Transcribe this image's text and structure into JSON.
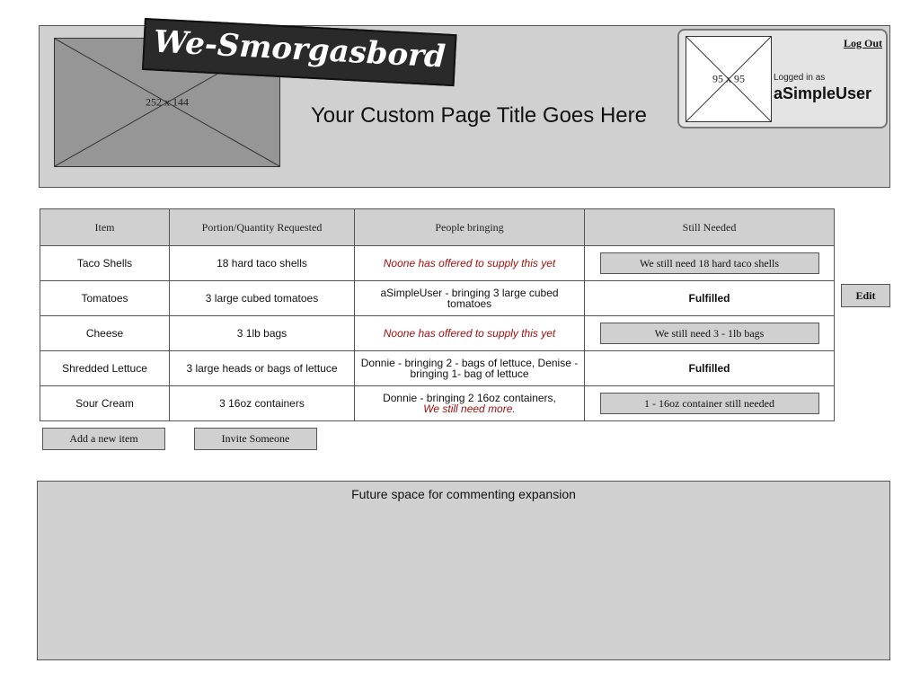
{
  "header": {
    "hero_placeholder": "252 x 144",
    "logo_text": "We-Smorgasbord",
    "page_title": "Your Custom Page Title Goes Here"
  },
  "user": {
    "avatar_placeholder": "95 x 95",
    "logout_label": "Log Out",
    "logged_in_label": "Logged in as",
    "username": "aSimpleUser"
  },
  "table": {
    "headers": [
      "Item",
      "Portion/Quantity Requested",
      "People bringing",
      "Still Needed"
    ],
    "rows": [
      {
        "item": "Taco Shells",
        "quantity": "18 hard taco shells",
        "bringing": "Noone has offered to supply this yet",
        "still_needed": "We still need 18 hard taco shells"
      },
      {
        "item": "Tomatoes",
        "quantity": "3 large cubed tomatoes",
        "bringing": "aSimpleUser - bringing 3 large cubed tomatoes",
        "still_needed": "Fulfilled"
      },
      {
        "item": "Cheese",
        "quantity": "3 1lb bags",
        "bringing": "Noone has offered to supply this yet",
        "still_needed": "We still need 3 - 1lb bags"
      },
      {
        "item": "Shredded Lettuce",
        "quantity": "3 large heads or bags of lettuce",
        "bringing": "Donnie - bringing 2 - bags of lettuce, Denise - bringing 1- bag of lettuce",
        "still_needed": "Fulfilled"
      },
      {
        "item": "Sour Cream",
        "quantity": "3 16oz containers",
        "bringing": "Donnie - bringing 2 16oz containers,",
        "bringing_note": "We still need more.",
        "still_needed": "1 - 16oz container still needed"
      }
    ]
  },
  "actions": {
    "edit_label": "Edit",
    "add_item_label": "Add a new item",
    "invite_label": "Invite Someone"
  },
  "comments": {
    "label": "Future space for commenting expansion"
  }
}
